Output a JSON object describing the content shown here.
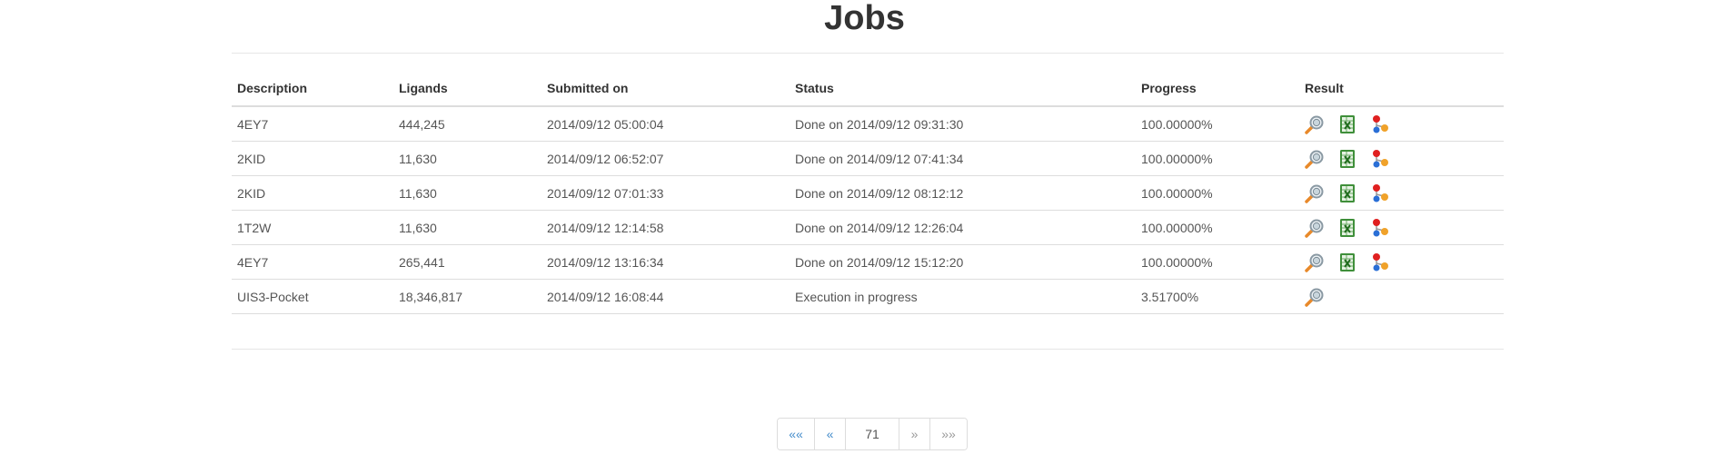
{
  "page": {
    "title": "Jobs"
  },
  "table": {
    "headers": {
      "description": "Description",
      "ligands": "Ligands",
      "submitted_on": "Submitted on",
      "status": "Status",
      "progress": "Progress",
      "result": "Result"
    },
    "rows": [
      {
        "description": "4EY7",
        "ligands": "444,245",
        "submitted_on": "2014/09/12 05:00:04",
        "status": "Done on 2014/09/12 09:31:30",
        "progress": "100.00000%"
      },
      {
        "description": "2KID",
        "ligands": "11,630",
        "submitted_on": "2014/09/12 06:52:07",
        "status": "Done on 2014/09/12 07:41:34",
        "progress": "100.00000%"
      },
      {
        "description": "2KID",
        "ligands": "11,630",
        "submitted_on": "2014/09/12 07:01:33",
        "status": "Done on 2014/09/12 08:12:12",
        "progress": "100.00000%"
      },
      {
        "description": "1T2W",
        "ligands": "11,630",
        "submitted_on": "2014/09/12 12:14:58",
        "status": "Done on 2014/09/12 12:26:04",
        "progress": "100.00000%"
      },
      {
        "description": "4EY7",
        "ligands": "265,441",
        "submitted_on": "2014/09/12 13:16:34",
        "status": "Done on 2014/09/12 15:12:20",
        "progress": "100.00000%"
      },
      {
        "description": "UIS3-Pocket",
        "ligands": "18,346,817",
        "submitted_on": "2014/09/12 16:08:44",
        "status": "Execution in progress",
        "progress": "3.51700%"
      }
    ],
    "result_icons": [
      "magnifier-icon",
      "spreadsheet-icon",
      "molecule-icon"
    ]
  },
  "pagination": {
    "first": "««",
    "prev": "«",
    "current": "71",
    "next": "»",
    "last": "»»"
  },
  "colors": {
    "link": "#428bca",
    "border": "#dddddd",
    "text": "#333333"
  }
}
